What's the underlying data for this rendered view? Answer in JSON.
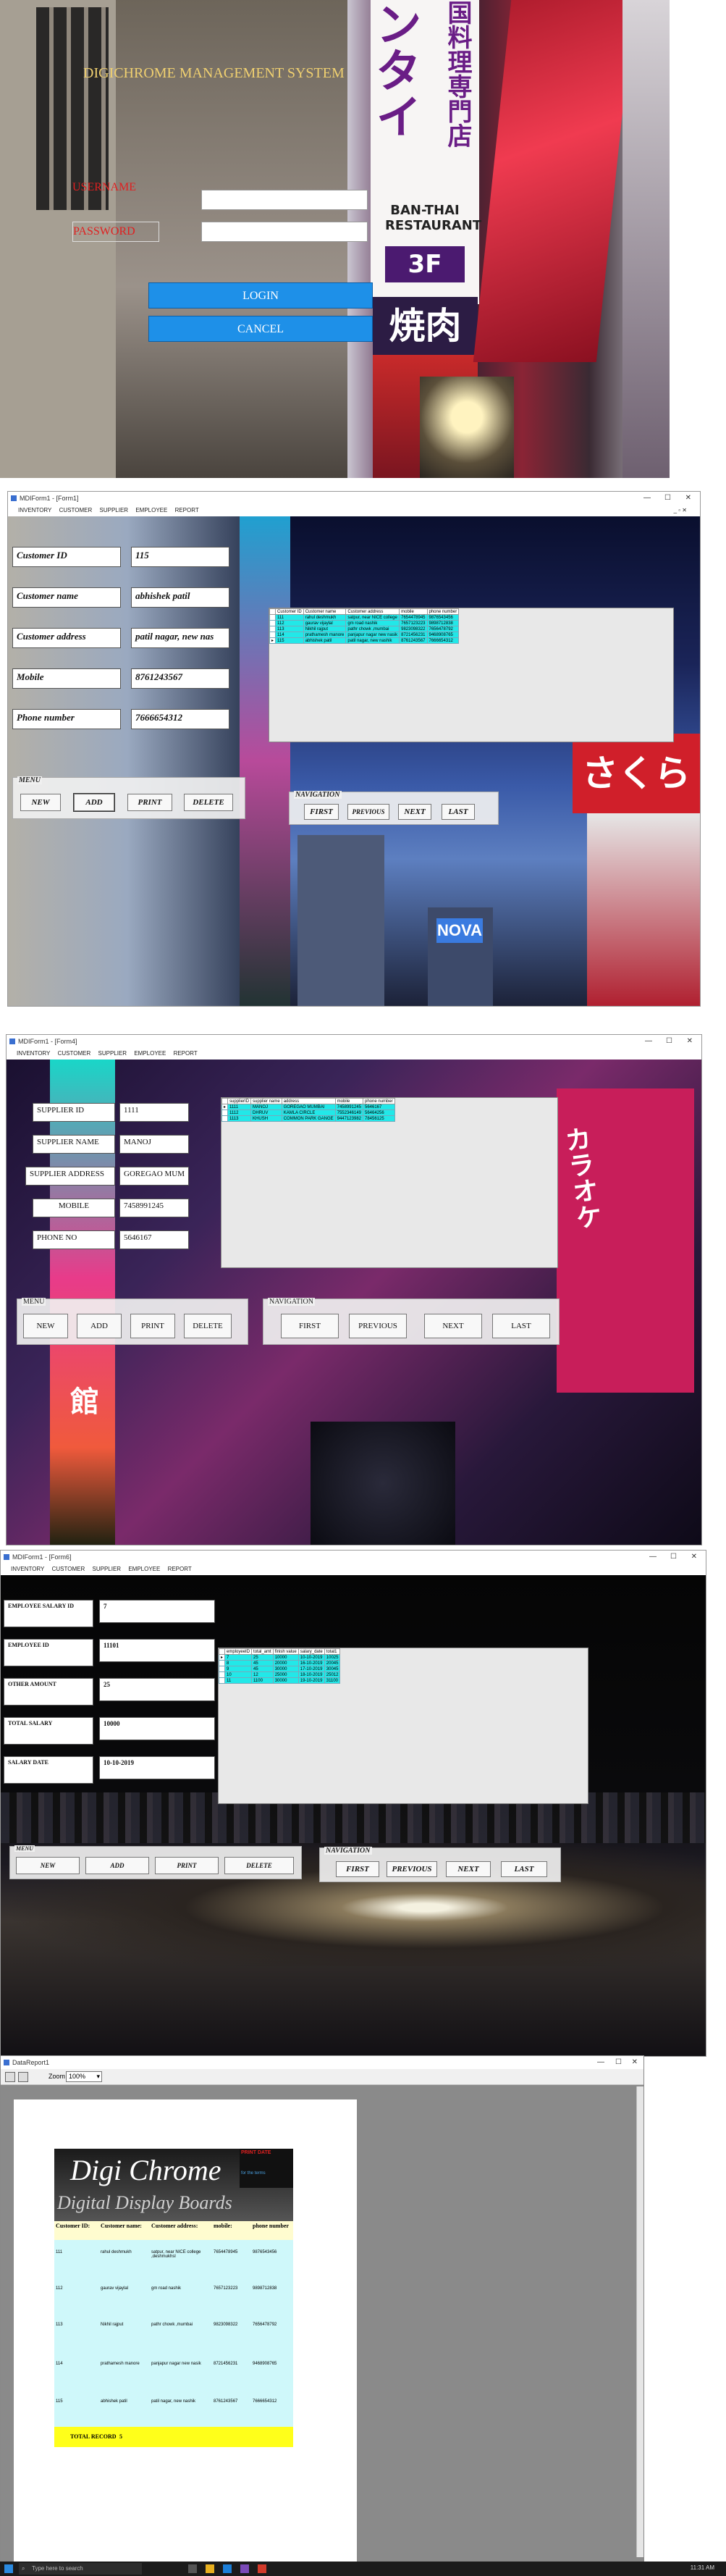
{
  "login": {
    "title": "DIGICHROME MANAGEMENT SYSTEM",
    "username_label": "USERNAME",
    "password_label": "PASSWORD",
    "login_button": "LOGIN",
    "cancel_button": "CANCEL",
    "sign_left_chars": "ンタイ",
    "sign_right_chars": "国料理専門店",
    "sign_restaurant": "BAN-THAI RESTAURANT",
    "sign_floor": "3F",
    "sign_yakiniku": "焼肉"
  },
  "customer_form": {
    "window_title": "MDIForm1 - [Form1]",
    "menu": [
      "INVENTORY",
      "CUSTOMER",
      "SUPPLIER",
      "EMPLOYEE",
      "REPORT"
    ],
    "fields": [
      {
        "label": "Customer ID",
        "value": "115"
      },
      {
        "label": "Customer name",
        "value": "abhishek patil"
      },
      {
        "label": "Customer address",
        "value": "patil nagar, new nas"
      },
      {
        "label": "Mobile",
        "value": "8761243567"
      },
      {
        "label": "Phone number",
        "value": "7666654312"
      }
    ],
    "menu_group_label": "MENU",
    "buttons": [
      "NEW",
      "ADD",
      "PRINT",
      "DELETE"
    ],
    "nav_group_label": "NAVIGATION",
    "nav_buttons": [
      "FIRST",
      "PREVIOUS",
      "NEXT",
      "LAST"
    ],
    "grid_columns": [
      "Customer ID",
      "Customer name",
      "Customer address",
      "mobile",
      "phone number"
    ],
    "grid_rows": [
      [
        "111",
        "rahul deshmukh",
        "satpur, near NICE college",
        "7654478945",
        "9876543456"
      ],
      [
        "112",
        "gaurav vijaylal",
        "gm road nashik",
        "7657123223",
        "9898712838"
      ],
      [
        "113",
        "Nikhil rajput",
        "pathr chowk ,mumbai",
        "9823098322",
        "7656478792"
      ],
      [
        "114",
        "prathamesh manore",
        "panjapur nagar new nasik",
        "8721456231",
        "9468908765"
      ],
      [
        "115",
        "abhishek patil",
        "patil nagar, new nashik",
        "8761243567",
        "7666654312"
      ]
    ],
    "sign_text": "さくら",
    "sign_nova": "NOVA"
  },
  "supplier_form": {
    "window_title": "MDIForm1 - [Form4]",
    "menu": [
      "INVENTORY",
      "CUSTOMER",
      "SUPPLIER",
      "EMPLOYEE",
      "REPORT"
    ],
    "fields": [
      {
        "label": "SUPPLIER ID",
        "value": "1111"
      },
      {
        "label": "SUPPLIER NAME",
        "value": "MANOJ"
      },
      {
        "label": "SUPPLIER ADDRESS",
        "value": "GOREGAO MUM"
      },
      {
        "label": "MOBILE",
        "value": "7458991245"
      },
      {
        "label": "PHONE NO",
        "value": "5646167"
      }
    ],
    "menu_group_label": "MENU",
    "buttons": [
      "NEW",
      "ADD",
      "PRINT",
      "DELETE"
    ],
    "nav_group_label": "NAVIGATION",
    "nav_buttons": [
      "FIRST",
      "PREVIOUS",
      "NEXT",
      "LAST"
    ],
    "grid_columns": [
      "supplierID",
      "supplier name",
      "address",
      "mobile",
      "phone number"
    ],
    "grid_rows": [
      [
        "1111",
        "MANOJ",
        "GOREGAO MUMBAI",
        "7458991245",
        "5646167"
      ],
      [
        "1112",
        "DHRUV",
        "KAMLA CIRCLE",
        "7552346149",
        "56464256"
      ],
      [
        "1113",
        "KHUSH",
        "COMMON PARK GANGE",
        "9447123982",
        "78456125"
      ]
    ],
    "sign_text": "カラオケ",
    "sign_kan": "館"
  },
  "salary_form": {
    "window_title": "MDIForm1 - [Form6]",
    "menu": [
      "INVENTORY",
      "CUSTOMER",
      "SUPPLIER",
      "EMPLOYEE",
      "REPORT"
    ],
    "fields": [
      {
        "label": "EMPLOYEE SALARY ID",
        "value": "7"
      },
      {
        "label": "EMPLOYEE ID",
        "value": "11101"
      },
      {
        "label": "OTHER AMOUNT",
        "value": "25"
      },
      {
        "label": "TOTAL SALARY",
        "value": "10000"
      },
      {
        "label": "SALARY DATE",
        "value": "10-10-2019"
      }
    ],
    "menu_group_label": "MENU",
    "buttons": [
      "NEW",
      "ADD",
      "PRINT",
      "DELETE"
    ],
    "nav_group_label": "NAVIGATION",
    "nav_buttons": [
      "FIRST",
      "PREVIOUS",
      "NEXT",
      "LAST"
    ],
    "grid_columns": [
      "employeeID",
      "total_amt",
      "finish value",
      "salary_date",
      "total1"
    ],
    "grid_rows": [
      [
        "7",
        "25",
        "10000",
        "10-10-2019",
        "10025"
      ],
      [
        "8",
        "45",
        "20000",
        "16-10-2019",
        "20045"
      ],
      [
        "9",
        "45",
        "30000",
        "17-10-2019",
        "30045"
      ],
      [
        "10",
        "12",
        "25000",
        "18-10-2019",
        "25012"
      ],
      [
        "11",
        "1100",
        "30000",
        "19-10-2019",
        "31100"
      ]
    ]
  },
  "report_preview": {
    "window_title": "DataReport1",
    "zoom_label": "Zoom",
    "zoom_value": "100%",
    "report_title": "Digi Chrome",
    "report_subtitle": "Digital Display Boards",
    "corner_top": "PRINT DATE",
    "corner_bottom": "for the terms",
    "columns": [
      "Customer ID:",
      "Customer name:",
      "Customer address:",
      "mobile:",
      "phone number"
    ],
    "rows": [
      [
        "111",
        "rahul deshmukh",
        "satpur, near NICE college ,deshmukhsl",
        "7654478945",
        "9876543456"
      ],
      [
        "112",
        "gaurav vijaylal",
        "gm road nashik",
        "7657123223",
        "9898712838"
      ],
      [
        "113",
        "Nikhil rajput",
        "pathr chowk ,mumbai",
        "9823098322",
        "7656478792"
      ],
      [
        "114",
        "prathamesh manore",
        "panjapur nagar new nasik",
        "8721456231",
        "9468908765"
      ],
      [
        "115",
        "abhishek patil",
        "patil nagar, new nashik",
        "8761243567",
        "7666654312"
      ]
    ],
    "total_label": "TOTAL RECORD",
    "total_value": "5"
  },
  "taskbar": {
    "search_text": "Type here to search",
    "clock": "11:31 AM"
  }
}
